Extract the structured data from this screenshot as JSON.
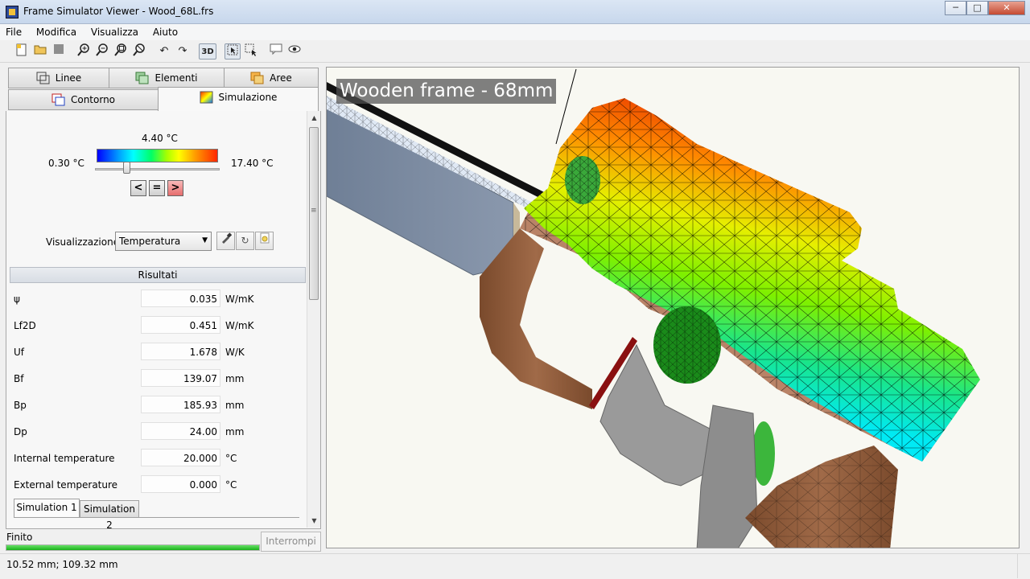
{
  "window": {
    "title": "Frame Simulator Viewer - Wood_68L.frs",
    "controls": [
      "─",
      "□",
      "✕"
    ]
  },
  "menu": [
    "File",
    "Modifica",
    "Visualizza",
    "Aiuto"
  ],
  "toolbar": {
    "btn3d": "3D",
    "icons": [
      "new-file-icon",
      "open-folder-icon",
      "stop-icon",
      "zoom-in-icon",
      "zoom-out-icon",
      "zoom-extent-icon",
      "zoom-window-icon",
      "undo-icon",
      "redo-icon",
      "3d-view-icon",
      "select-pointer-icon",
      "select-area-icon",
      "comment-icon",
      "eye-icon"
    ]
  },
  "tabs": {
    "linee": "Linee",
    "elementi": "Elementi",
    "aree": "Aree",
    "contorno": "Contorno",
    "simulazione": "Simulazione"
  },
  "legend": {
    "current": "4.40 °C",
    "min": "0.30 °C",
    "max": "17.40 °C",
    "prev": "<",
    "mid": "=",
    "next": ">"
  },
  "visualization": {
    "label": "Visualizzazione:",
    "selected": "Temperatura"
  },
  "results": {
    "header": "Risultati",
    "rows": [
      {
        "label": "ψ",
        "value": "0.035",
        "unit": "W/mK"
      },
      {
        "label": "Lf2D",
        "value": "0.451",
        "unit": "W/mK"
      },
      {
        "label": "Uf",
        "value": "1.678",
        "unit": "W/K"
      },
      {
        "label": "Bf",
        "value": "139.07",
        "unit": "mm"
      },
      {
        "label": "Bp",
        "value": "185.93",
        "unit": "mm"
      },
      {
        "label": "Dp",
        "value": "24.00",
        "unit": "mm"
      },
      {
        "label": "Internal temperature",
        "value": "20.000",
        "unit": "°C"
      },
      {
        "label": "External temperature",
        "value": "0.000",
        "unit": "°C"
      }
    ]
  },
  "sim_tabs": [
    "Simulation 1",
    "Simulation 2"
  ],
  "status": {
    "state": "Finito",
    "progress": 1.0,
    "stop_label": "Interrompi",
    "coords": "10.52 mm; 109.32 mm"
  },
  "viewport": {
    "title": "Wooden frame - 68mm"
  }
}
